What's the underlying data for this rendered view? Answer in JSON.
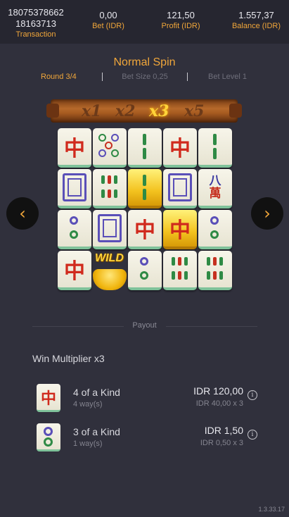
{
  "header": {
    "transaction_line1": "18075378662",
    "transaction_line2": "18163713",
    "transaction_label": "Transaction",
    "bet_value": "0,00",
    "bet_label": "Bet (IDR)",
    "profit_value": "121,50",
    "profit_label": "Profit (IDR)",
    "balance_value": "1.557,37",
    "balance_label": "Balance (IDR)"
  },
  "spin": {
    "title": "Normal Spin",
    "round": "Round 3/4",
    "bet_size": "Bet Size 0,25",
    "bet_level": "Bet Level 1"
  },
  "multipliers": [
    "x1",
    "x2",
    "x3",
    "x5"
  ],
  "active_multiplier_index": 2,
  "board": {
    "wild_label": "WILD",
    "zhong_char": "中",
    "ba_wan": [
      "八",
      "萬"
    ]
  },
  "payout": {
    "heading": "Payout",
    "win_multiplier": "Win Multiplier x3",
    "rows": [
      {
        "name": "4 of a Kind",
        "ways": "4 way(s)",
        "amount": "IDR 120,00",
        "calc": "IDR 40,00 x 3",
        "symbol_char": "中"
      },
      {
        "name": "3 of a Kind",
        "ways": "1 way(s)",
        "amount": "IDR 1,50",
        "calc": "IDR 0,50 x 3"
      }
    ]
  },
  "nav": {
    "prev_glyph": "‹",
    "next_glyph": "›",
    "info_glyph": "i"
  },
  "version": "1.3.33.17",
  "colors": {
    "accent": "#f0a63a",
    "background": "#30303c",
    "header": "#262630",
    "active_multiplier": "#ffd43a"
  }
}
